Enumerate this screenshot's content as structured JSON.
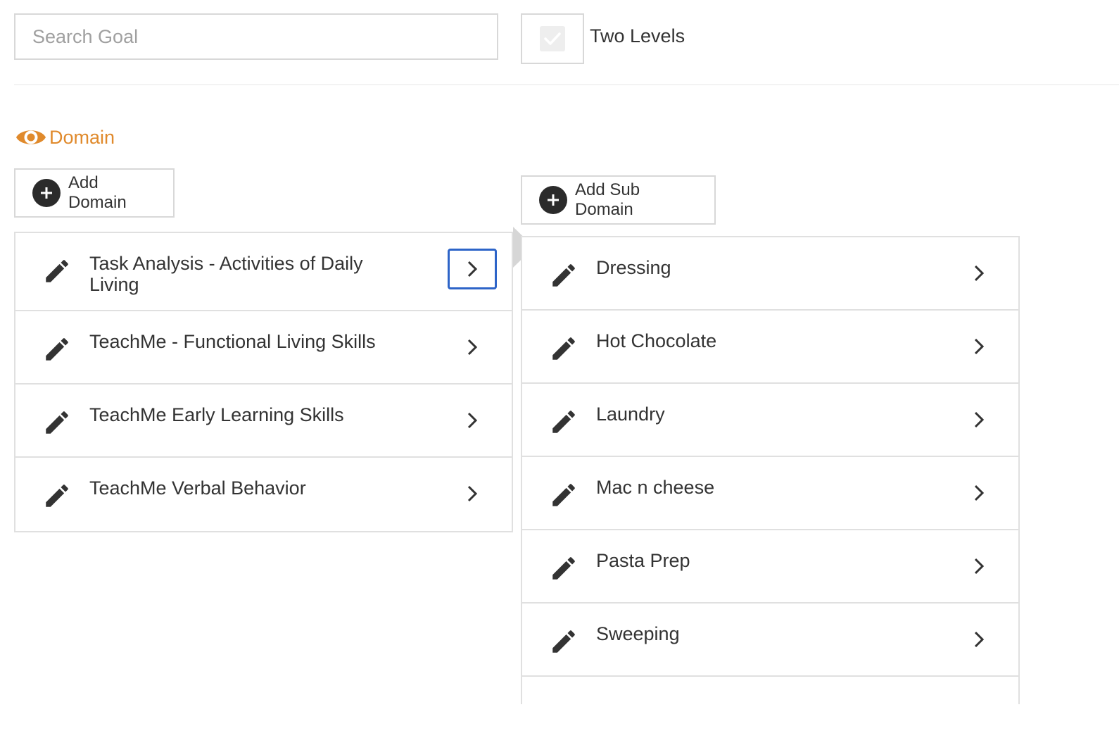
{
  "search": {
    "placeholder": "Search Goal",
    "value": ""
  },
  "two_levels": {
    "label": "Two Levels",
    "checked": true
  },
  "section": {
    "title": "Domain",
    "icon": "eye-icon",
    "color": "#e08a2c"
  },
  "domain_panel": {
    "add_label": "Add Domain",
    "items": [
      {
        "label": "Task Analysis - Activities of Daily Living",
        "selected": true
      },
      {
        "label": "TeachMe - Functional Living Skills",
        "selected": false
      },
      {
        "label": "TeachMe Early Learning Skills",
        "selected": false
      },
      {
        "label": "TeachMe Verbal Behavior",
        "selected": false
      }
    ]
  },
  "subdomain_panel": {
    "add_label": "Add Sub Domain",
    "items": [
      {
        "label": "Dressing"
      },
      {
        "label": "Hot Chocolate"
      },
      {
        "label": "Laundry"
      },
      {
        "label": "Mac n cheese"
      },
      {
        "label": "Pasta Prep"
      },
      {
        "label": "Sweeping"
      },
      {
        "label": ""
      }
    ]
  },
  "colors": {
    "accent": "#e08a2c",
    "focus": "#2d64c8",
    "text": "#333333",
    "border": "#e0e0e0"
  }
}
